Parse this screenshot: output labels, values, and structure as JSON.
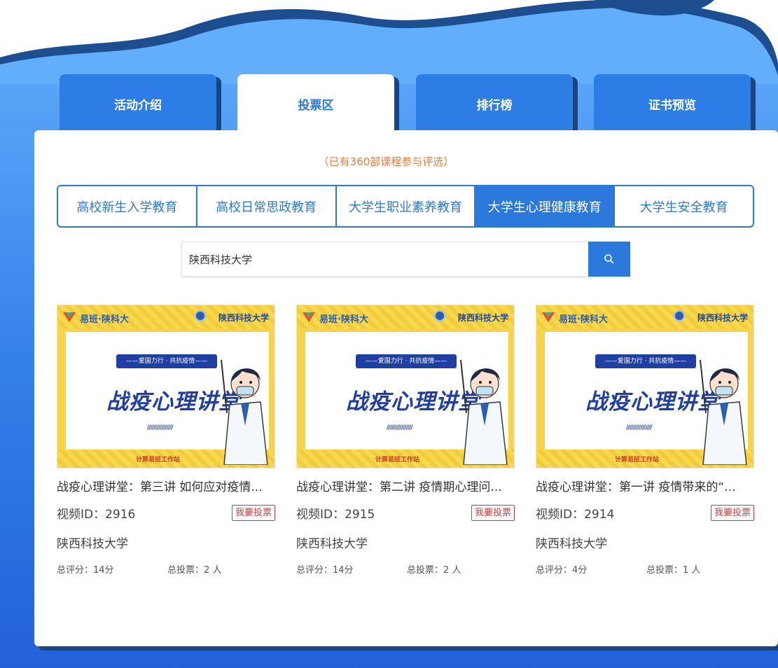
{
  "tabs": [
    {
      "label": "活动介绍",
      "active": false
    },
    {
      "label": "投票区",
      "active": true
    },
    {
      "label": "排行榜",
      "active": false
    },
    {
      "label": "证书预览",
      "active": false
    }
  ],
  "count_note": "（已有360部课程参与评选）",
  "categories": [
    {
      "label": "高校新生入学教育",
      "active": false
    },
    {
      "label": "高校日常思政教育",
      "active": false
    },
    {
      "label": "大学生职业素养教育",
      "active": false
    },
    {
      "label": "大学生心理健康教育",
      "active": true
    },
    {
      "label": "大学生安全教育",
      "active": false
    }
  ],
  "search": {
    "value": "陕西科技大学",
    "icon": "search-icon"
  },
  "thumbnail": {
    "brand_left": "易班·陕科大",
    "brand_right": "陕西科技大学",
    "ribbon": "——爱国力行 · 共抗疫情——",
    "headline": "战疫心理讲堂",
    "slashes": "////////////////",
    "caption": "计算易班工作站"
  },
  "videos": [
    {
      "title": "战疫心理讲堂：第三讲 如何应对疫情...",
      "video_id": "视频ID：2916",
      "vote_label": "我要投票",
      "school": "陕西科技大学",
      "score": "总评分：14分",
      "votes": "总投票：2 人"
    },
    {
      "title": "战疫心理讲堂：第二讲 疫情期心理问...",
      "video_id": "视频ID：2915",
      "vote_label": "我要投票",
      "school": "陕西科技大学",
      "score": "总评分：14分",
      "votes": "总投票：2 人"
    },
    {
      "title": "战疫心理讲堂：第一讲 疫情带来的“...",
      "video_id": "视频ID：2914",
      "vote_label": "我要投票",
      "school": "陕西科技大学",
      "score": "总评分：4分",
      "votes": "总投票：1 人"
    }
  ],
  "colors": {
    "accent": "#2b79dd",
    "vote": "#d23b3b",
    "note": "#ed7d3a",
    "background": "#4b96f3"
  }
}
